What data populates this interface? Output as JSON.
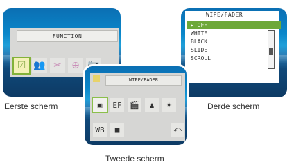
{
  "screens": {
    "first": {
      "caption": "Eerste scherm",
      "title": "FUNCTION",
      "icons": [
        {
          "name": "check-icon",
          "glyph": "☑",
          "selected": true
        },
        {
          "name": "people-icon",
          "glyph": "👥",
          "selected": false
        },
        {
          "name": "effects-icon",
          "glyph": "✂",
          "selected": false
        },
        {
          "name": "plus-circle-icon",
          "glyph": "⊕",
          "selected": false
        },
        {
          "name": "camera-icon",
          "glyph": "📷",
          "selected": false
        }
      ]
    },
    "second": {
      "caption": "Tweede scherm",
      "title": "WIPE/FADER",
      "icons_row1": [
        {
          "name": "wipe-fader-icon",
          "glyph": "▣",
          "selected": true
        },
        {
          "name": "ef-icon",
          "glyph": "EF",
          "selected": false
        },
        {
          "name": "clapper-icon",
          "glyph": "🎬",
          "selected": false
        },
        {
          "name": "person-icon",
          "glyph": "♟",
          "selected": false
        },
        {
          "name": "brightness-icon",
          "glyph": "☀",
          "selected": false
        }
      ],
      "icons_row2": [
        {
          "name": "wb-icon",
          "glyph": "WB",
          "selected": false
        },
        {
          "name": "record-icon",
          "glyph": "■",
          "selected": false
        }
      ],
      "return_icon": {
        "name": "return-icon",
        "glyph": "⤺"
      }
    },
    "third": {
      "caption": "Derde scherm",
      "title": "WIPE/FADER",
      "items": [
        {
          "label": "▸ OFF",
          "selected": true
        },
        {
          "label": "WHITE",
          "selected": false
        },
        {
          "label": "BLACK",
          "selected": false
        },
        {
          "label": "SLIDE",
          "selected": false
        },
        {
          "label": "SCROLL",
          "selected": false
        }
      ]
    }
  }
}
